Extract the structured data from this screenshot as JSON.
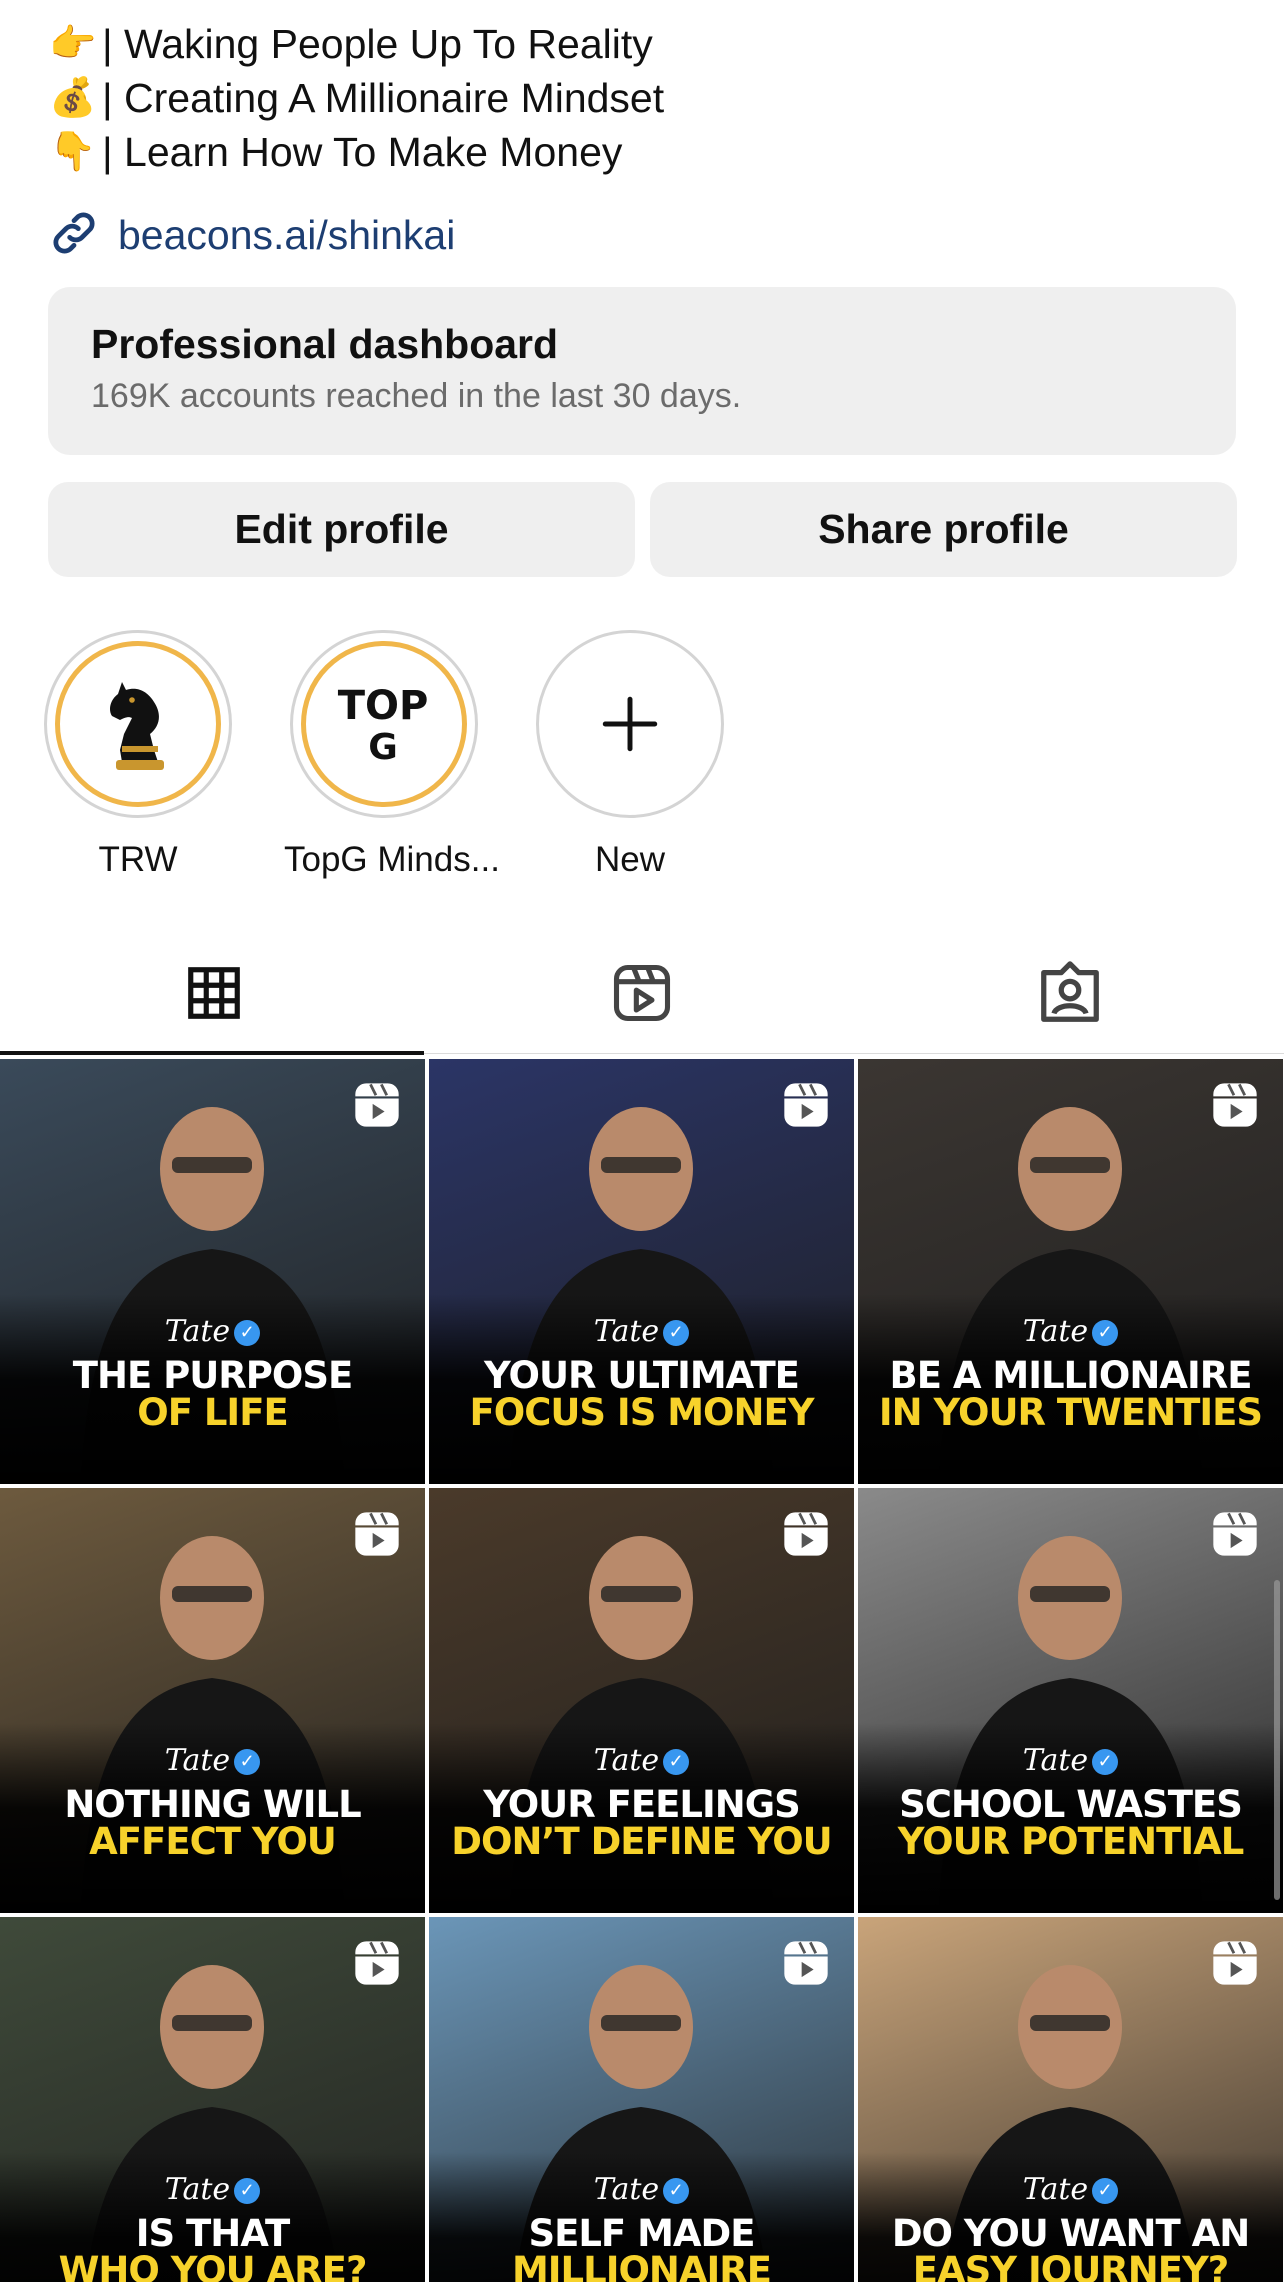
{
  "bio": {
    "lines": [
      {
        "emoji": "👉",
        "text": "| Waking People Up To Reality"
      },
      {
        "emoji": "💰",
        "text": "| Creating A Millionaire Mindset"
      },
      {
        "emoji": "👇",
        "text": "| Learn How To Make Money"
      }
    ],
    "link": "beacons.ai/shinkai"
  },
  "dashboard": {
    "title": "Professional dashboard",
    "subtitle": "169K accounts reached in the last 30 days."
  },
  "actions": {
    "edit_label": "Edit profile",
    "share_label": "Share profile"
  },
  "highlights": [
    {
      "label": "TRW"
    },
    {
      "label": "TopG Minds..."
    },
    {
      "label": "New"
    }
  ],
  "tabs": [
    {
      "name": "grid",
      "icon": "grid-icon",
      "active": true
    },
    {
      "name": "reels",
      "icon": "reels-icon",
      "active": false
    },
    {
      "name": "tagged",
      "icon": "tagged-person-icon",
      "active": false
    }
  ],
  "posts": [
    {
      "brand": "Tate",
      "line1": "THE PURPOSE",
      "line2": "OF LIFE",
      "bg": "#3a4a5a"
    },
    {
      "brand": "Tate",
      "line1": "YOUR ULTIMATE",
      "line2": "FOCUS IS MONEY",
      "bg": "#2b3566"
    },
    {
      "brand": "Tate",
      "line1": "BE A MILLIONAIRE",
      "line2": "IN YOUR TWENTIES",
      "bg": "#3b3632"
    },
    {
      "brand": "Tate",
      "line1": "NOTHING WILL",
      "line2": "AFFECT YOU",
      "bg": "#6d5a3e"
    },
    {
      "brand": "Tate",
      "line1": "YOUR FEELINGS",
      "line2": "DON’T DEFINE YOU",
      "bg": "#4a3a2a"
    },
    {
      "brand": "Tate",
      "line1": "SCHOOL WASTES",
      "line2": "YOUR POTENTIAL",
      "bg": "#8a8a8a"
    },
    {
      "brand": "Tate",
      "line1": "IS THAT",
      "line2": "WHO YOU ARE?",
      "bg": "#3f4a3a"
    },
    {
      "brand": "Tate",
      "line1": "SELF MADE",
      "line2": "MILLIONAIRE",
      "bg": "#6b96b8"
    },
    {
      "brand": "Tate",
      "line1": "DO YOU WANT AN",
      "line2": "EASY JOURNEY?",
      "bg": "#c9a47a"
    }
  ],
  "colors": {
    "link": "#1d3e72",
    "highlight_ring": "#f0b64a",
    "caption_accent": "#f7d22b",
    "verified": "#3897f0"
  }
}
